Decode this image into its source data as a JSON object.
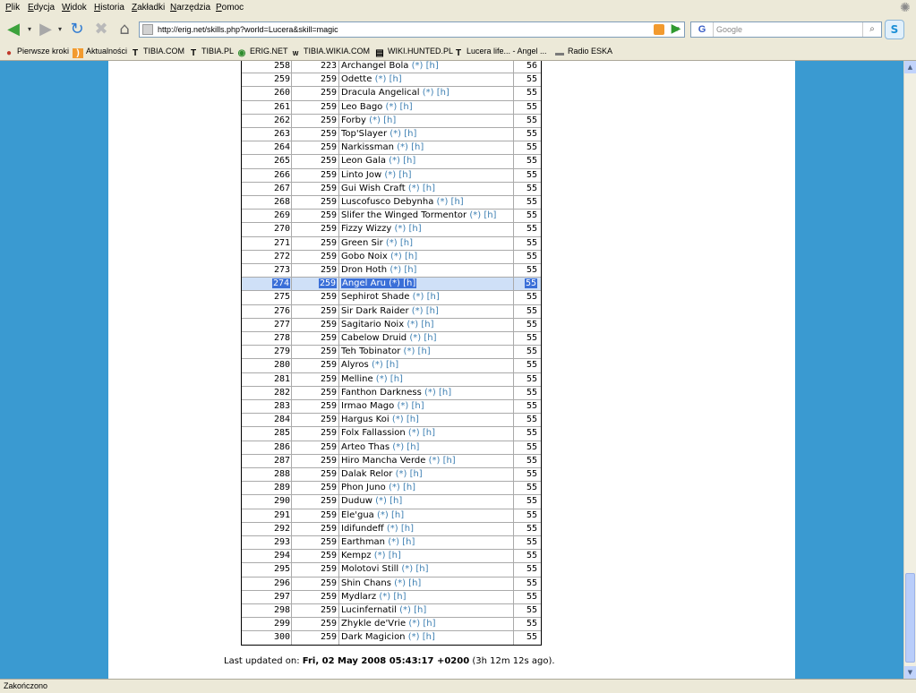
{
  "menu": [
    "Plik",
    "Edycja",
    "Widok",
    "Historia",
    "Zakładki",
    "Narzędzia",
    "Pomoc"
  ],
  "navbar": {
    "url": "http://erig.net/skills.php?world=Lucera&skill=magic",
    "search_placeholder": "Google",
    "search_engine": "G"
  },
  "bookmarks": [
    {
      "label": "Pierwsze kroki",
      "icon": "bookmark-icon"
    },
    {
      "label": "Aktualności",
      "icon": "rss-icon"
    },
    {
      "label": "TIBIA.COM",
      "icon": "tibia-icon"
    },
    {
      "label": "TIBIA.PL",
      "icon": "tibia-icon"
    },
    {
      "label": "ERIG.NET",
      "icon": "globe-icon"
    },
    {
      "label": "TIBIA.WIKIA.COM",
      "icon": "wiki-icon"
    },
    {
      "label": "WIKI.HUNTED.PL",
      "icon": "page-icon"
    },
    {
      "label": "Lucera life... - Angel ...",
      "icon": "tibia-icon"
    },
    {
      "label": "Radio ESKA",
      "icon": "radio-icon"
    }
  ],
  "table": {
    "selected_rank": 274,
    "link_star": "(*)",
    "link_h": "[h]",
    "rows": [
      {
        "rank": 258,
        "prev": 223,
        "name": "Archangel Bola",
        "level": 56
      },
      {
        "rank": 259,
        "prev": 259,
        "name": "Odette",
        "level": 55
      },
      {
        "rank": 260,
        "prev": 259,
        "name": "Dracula Angelical",
        "level": 55
      },
      {
        "rank": 261,
        "prev": 259,
        "name": "Leo Bago",
        "level": 55
      },
      {
        "rank": 262,
        "prev": 259,
        "name": "Forby",
        "level": 55
      },
      {
        "rank": 263,
        "prev": 259,
        "name": "Top'Slayer",
        "level": 55
      },
      {
        "rank": 264,
        "prev": 259,
        "name": "Narkissman",
        "level": 55
      },
      {
        "rank": 265,
        "prev": 259,
        "name": "Leon Gala",
        "level": 55
      },
      {
        "rank": 266,
        "prev": 259,
        "name": "Linto Jow",
        "level": 55
      },
      {
        "rank": 267,
        "prev": 259,
        "name": "Gui Wish Craft",
        "level": 55
      },
      {
        "rank": 268,
        "prev": 259,
        "name": "Luscofusco Debynha",
        "level": 55
      },
      {
        "rank": 269,
        "prev": 259,
        "name": "Slifer the Winged Tormentor",
        "level": 55
      },
      {
        "rank": 270,
        "prev": 259,
        "name": "Fizzy Wizzy",
        "level": 55
      },
      {
        "rank": 271,
        "prev": 259,
        "name": "Green Sir",
        "level": 55
      },
      {
        "rank": 272,
        "prev": 259,
        "name": "Gobo Noix",
        "level": 55
      },
      {
        "rank": 273,
        "prev": 259,
        "name": "Dron Hoth",
        "level": 55
      },
      {
        "rank": 274,
        "prev": 259,
        "name": "Angel Aru",
        "level": 55
      },
      {
        "rank": 275,
        "prev": 259,
        "name": "Sephirot Shade",
        "level": 55
      },
      {
        "rank": 276,
        "prev": 259,
        "name": "Sir Dark Raider",
        "level": 55
      },
      {
        "rank": 277,
        "prev": 259,
        "name": "Sagitario Noix",
        "level": 55
      },
      {
        "rank": 278,
        "prev": 259,
        "name": "Cabelow Druid",
        "level": 55
      },
      {
        "rank": 279,
        "prev": 259,
        "name": "Teh Tobinator",
        "level": 55
      },
      {
        "rank": 280,
        "prev": 259,
        "name": "Alyros",
        "level": 55
      },
      {
        "rank": 281,
        "prev": 259,
        "name": "Melline",
        "level": 55
      },
      {
        "rank": 282,
        "prev": 259,
        "name": "Fanthon Darkness",
        "level": 55
      },
      {
        "rank": 283,
        "prev": 259,
        "name": "Irmao Mago",
        "level": 55
      },
      {
        "rank": 284,
        "prev": 259,
        "name": "Hargus Koi",
        "level": 55
      },
      {
        "rank": 285,
        "prev": 259,
        "name": "Folx Fallassion",
        "level": 55
      },
      {
        "rank": 286,
        "prev": 259,
        "name": "Arteo Thas",
        "level": 55
      },
      {
        "rank": 287,
        "prev": 259,
        "name": "Hiro Mancha Verde",
        "level": 55
      },
      {
        "rank": 288,
        "prev": 259,
        "name": "Dalak Relor",
        "level": 55
      },
      {
        "rank": 289,
        "prev": 259,
        "name": "Phon Juno",
        "level": 55
      },
      {
        "rank": 290,
        "prev": 259,
        "name": "Duduw",
        "level": 55
      },
      {
        "rank": 291,
        "prev": 259,
        "name": "Ele'gua",
        "level": 55
      },
      {
        "rank": 292,
        "prev": 259,
        "name": "Idifundeff",
        "level": 55
      },
      {
        "rank": 293,
        "prev": 259,
        "name": "Earthman",
        "level": 55
      },
      {
        "rank": 294,
        "prev": 259,
        "name": "Kempz",
        "level": 55
      },
      {
        "rank": 295,
        "prev": 259,
        "name": "Molotovi Still",
        "level": 55
      },
      {
        "rank": 296,
        "prev": 259,
        "name": "Shin Chans",
        "level": 55
      },
      {
        "rank": 297,
        "prev": 259,
        "name": "Mydlarz",
        "level": 55
      },
      {
        "rank": 298,
        "prev": 259,
        "name": "Lucinfernatil",
        "level": 55
      },
      {
        "rank": 299,
        "prev": 259,
        "name": "Zhykle de'Vrie",
        "level": 55
      },
      {
        "rank": 300,
        "prev": 259,
        "name": "Dark Magicion",
        "level": 55
      }
    ]
  },
  "footer": {
    "prefix": "Last updated on: ",
    "date": "Fri, 02 May 2008 05:43:17 +0200",
    "suffix": " (3h 12m 12s ago)."
  },
  "status": "Zakończono",
  "colors": {
    "page_bg": "#3a9ad1",
    "link": "#3d7fb2",
    "selection_row": "#cfe0f7",
    "selection_text": "#3a6fd8"
  }
}
